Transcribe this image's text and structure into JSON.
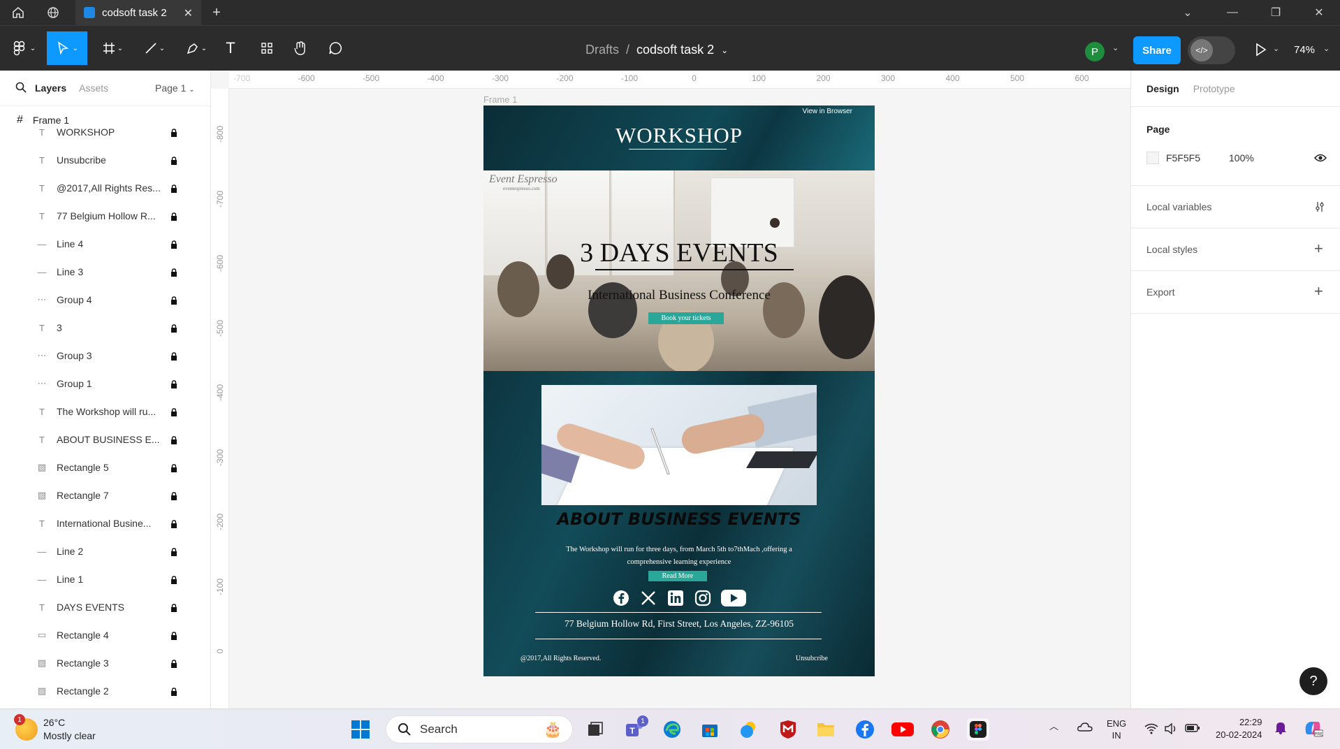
{
  "titlebar": {
    "tab_title": "codsoft task 2"
  },
  "toolbar": {
    "breadcrumb_parent": "Drafts",
    "breadcrumb_sep": "/",
    "file_name": "codsoft task 2",
    "avatar_letter": "P",
    "share_label": "Share",
    "zoom_level": "74%"
  },
  "left_panel": {
    "tab_layers": "Layers",
    "tab_assets": "Assets",
    "page_selector": "Page 1",
    "frame_name": "Frame 1",
    "layers": [
      {
        "name": "WORKSHOP",
        "icon": "text-icon"
      },
      {
        "name": "Unsubcribe",
        "icon": "text-icon"
      },
      {
        "name": "@2017,All Rights Res...",
        "icon": "text-icon"
      },
      {
        "name": "77 Belgium Hollow R...",
        "icon": "text-icon"
      },
      {
        "name": "Line 4",
        "icon": "line-icon"
      },
      {
        "name": "Line 3",
        "icon": "line-icon"
      },
      {
        "name": "Group 4",
        "icon": "group-icon"
      },
      {
        "name": "3",
        "icon": "text-icon"
      },
      {
        "name": "Group 3",
        "icon": "group-icon"
      },
      {
        "name": "Group 1",
        "icon": "group-icon"
      },
      {
        "name": "The Workshop will ru...",
        "icon": "text-icon"
      },
      {
        "name": "ABOUT BUSINESS E...",
        "icon": "text-icon"
      },
      {
        "name": "Rectangle 5",
        "icon": "image-icon"
      },
      {
        "name": "Rectangle 7",
        "icon": "image-icon"
      },
      {
        "name": "International Busine...",
        "icon": "text-icon"
      },
      {
        "name": "Line 2",
        "icon": "line-icon"
      },
      {
        "name": "Line 1",
        "icon": "line-icon"
      },
      {
        "name": "DAYS EVENTS",
        "icon": "text-icon"
      },
      {
        "name": "Rectangle 4",
        "icon": "rectangle-icon"
      },
      {
        "name": "Rectangle 3",
        "icon": "image-icon"
      },
      {
        "name": "Rectangle 2",
        "icon": "image-icon"
      }
    ]
  },
  "canvas": {
    "ruler_top": [
      "-700",
      "-600",
      "-500",
      "-400",
      "-300",
      "-200",
      "-100",
      "0",
      "100",
      "200",
      "300",
      "400",
      "500",
      "600"
    ],
    "ruler_left": [
      "-800",
      "-700",
      "-600",
      "-500",
      "-400",
      "-300",
      "-200",
      "-100",
      "0"
    ],
    "frame_label": "Frame 1"
  },
  "email": {
    "view_in_browser": "View in Browser",
    "workshop_title": "WORKSHOP",
    "watermark": "Event Espresso",
    "watermark_sub": "eventespresso.com",
    "days_title": "3 DAYS EVENTS",
    "conference": "International Business Conference",
    "book_button": "Book your tickets",
    "about_title": "ABOUT BUSINESS EVENTS",
    "description": "The Workshop will run for three days, from March 5th to7thMach ,offering a comprehensive learning experience",
    "read_more": "Read More",
    "address": "77 Belgium Hollow Rd, First Street, Los Angeles, ZZ-96105",
    "copyright": "@2017,All Rights Reserved.",
    "unsubscribe": "Unsubcribe"
  },
  "right_panel": {
    "tab_design": "Design",
    "tab_prototype": "Prototype",
    "page_heading": "Page",
    "page_color": "F5F5F5",
    "page_opacity": "100%",
    "local_variables": "Local variables",
    "local_styles": "Local styles",
    "export": "Export",
    "help": "?"
  },
  "taskbar": {
    "temperature": "26°C",
    "weather": "Mostly clear",
    "weather_badge": "1",
    "search_placeholder": "Search",
    "teams_badge": "1",
    "lang_top": "ENG",
    "lang_bottom": "IN",
    "time": "22:29",
    "date": "20-02-2024"
  },
  "colors": {
    "accent": "#0d99ff",
    "email_teal": "#2ba79a",
    "email_dark": "#0f3844",
    "dark_chrome": "#2c2c2c"
  }
}
